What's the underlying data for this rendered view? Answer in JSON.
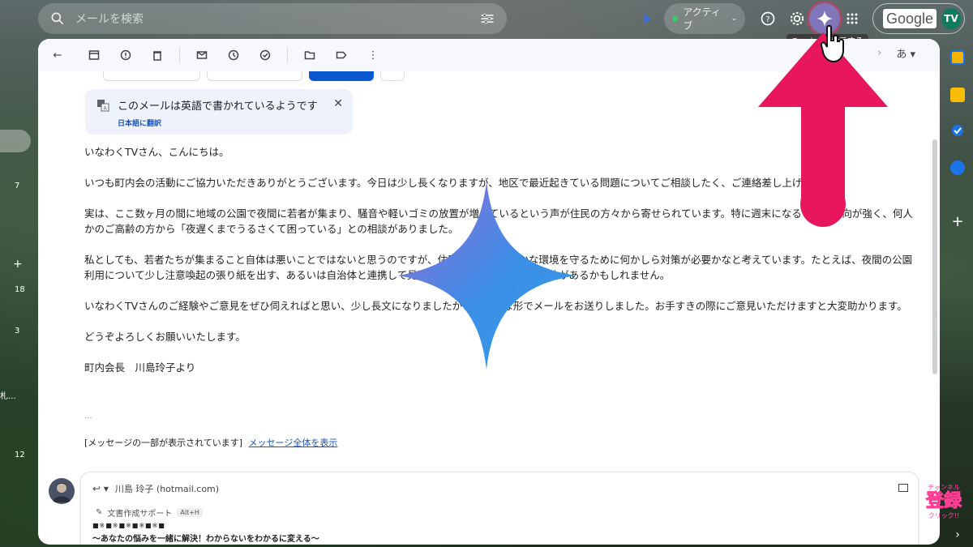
{
  "search": {
    "placeholder": "メールを検索"
  },
  "status": {
    "label": "アクティブ"
  },
  "tooltip": {
    "text": "Gemini を表示する"
  },
  "account": {
    "logo": "Google",
    "initials": "TV"
  },
  "left_rail": {
    "labels": [
      "7",
      "18",
      "3",
      "札...",
      "12"
    ]
  },
  "translate": {
    "title": "このメールは英語で書かれているようです",
    "link": "日本語に翻訳"
  },
  "email": {
    "paragraphs": [
      "いなわくTVさん、こんにちは。",
      "いつも町内会の活動にご協力いただきありがとうございます。今日は少し長くなりますが、地区で最近起きている問題についてご相談したく、ご連絡差し上げました。",
      "実は、ここ数ヶ月の間に地域の公園で夜間に若者が集まり、騒音や軽いゴミの放置が増えているという声が住民の方々から寄せられています。特に週末になるとその傾向が強く、何人かのご高齢の方から「夜遅くまでうるさくて困っている」との相談がありました。",
      "私としても、若者たちが集まること自体は悪いことではないと思うのですが、住民の方々が穏やかな環境を守るために何かしら対策が必要かなと考えています。たとえば、夜間の公園利用について少し注意喚起の張り紙を出す、あるいは自治体と連携して見回りを行うなど、いくつか方法があるかもしれません。",
      "いなわくTVさんのご経験やご意見をぜひ伺えればと思い、少し長文になりましたがこのような形でメールをお送りしました。お手すきの際にご意見いただけますと大変助かります。",
      "どうぞよろしくお願いいたします。",
      "町内会長　川島玲子より"
    ],
    "ellipsis": "...",
    "truncated_notice": "[メッセージの一部が表示されています]",
    "view_full": "メッセージ全体を表示"
  },
  "reply": {
    "to": "川島 玲子 (hotmail.com)",
    "assist_label": "文書作成サポート",
    "assist_shortcut": "Alt+H",
    "sig_line1": "■※■※■※■※■※■",
    "sig_line2": "〜あなたの悩みを一緒に解決！わからないをわかるに変える〜"
  },
  "toolbar": {
    "input_tool": "あ"
  },
  "subscribe": {
    "top": "チャンネル",
    "main": "登録",
    "bottom": "クリック!!"
  },
  "colors": {
    "accent_arrow": "#e8175d",
    "gemini_blue": "#3a8ee6",
    "gemini_purple": "#9b6ad6",
    "link": "#1a57b8"
  }
}
